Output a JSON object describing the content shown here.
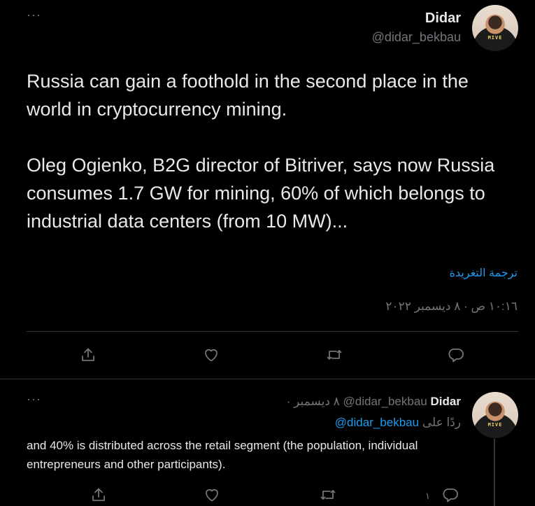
{
  "main_tweet": {
    "display_name": "Didar",
    "handle": "@didar_bekbau",
    "avatar_shirt_text": "MIVE",
    "paragraph1": "Russia can gain a foothold in the second place in the world in cryptocurrency mining.",
    "paragraph2": "Oleg Ogienko, B2G director of Bitriver, says now Russia consumes 1.7 GW for mining, 60% of which belongs to industrial data centers (from 10 MW)...",
    "translate_label": "ترجمة التغريدة",
    "timestamp": "١٠:١٦ ص · ٨ ديسمبر ٢٠٢٢",
    "actions": {
      "share_icon": "share-icon",
      "like_icon": "heart-icon",
      "retweet_icon": "retweet-icon",
      "reply_icon": "reply-icon"
    }
  },
  "reply_tweet": {
    "display_name": "Didar",
    "handle": "@didar_bekbau",
    "date": "· ٨ ديسمبر",
    "replying_prefix": "ردًا على",
    "replying_to": "@didar_bekbau",
    "avatar_shirt_text": "MIVE",
    "text": "and 40% is distributed across the retail segment (the population, individual entrepreneurs and other participants).",
    "reply_count": "١"
  },
  "colors": {
    "background": "#000000",
    "text": "#e7e9ea",
    "muted": "#71767b",
    "link": "#1d9bf0",
    "border": "#2f3336"
  }
}
